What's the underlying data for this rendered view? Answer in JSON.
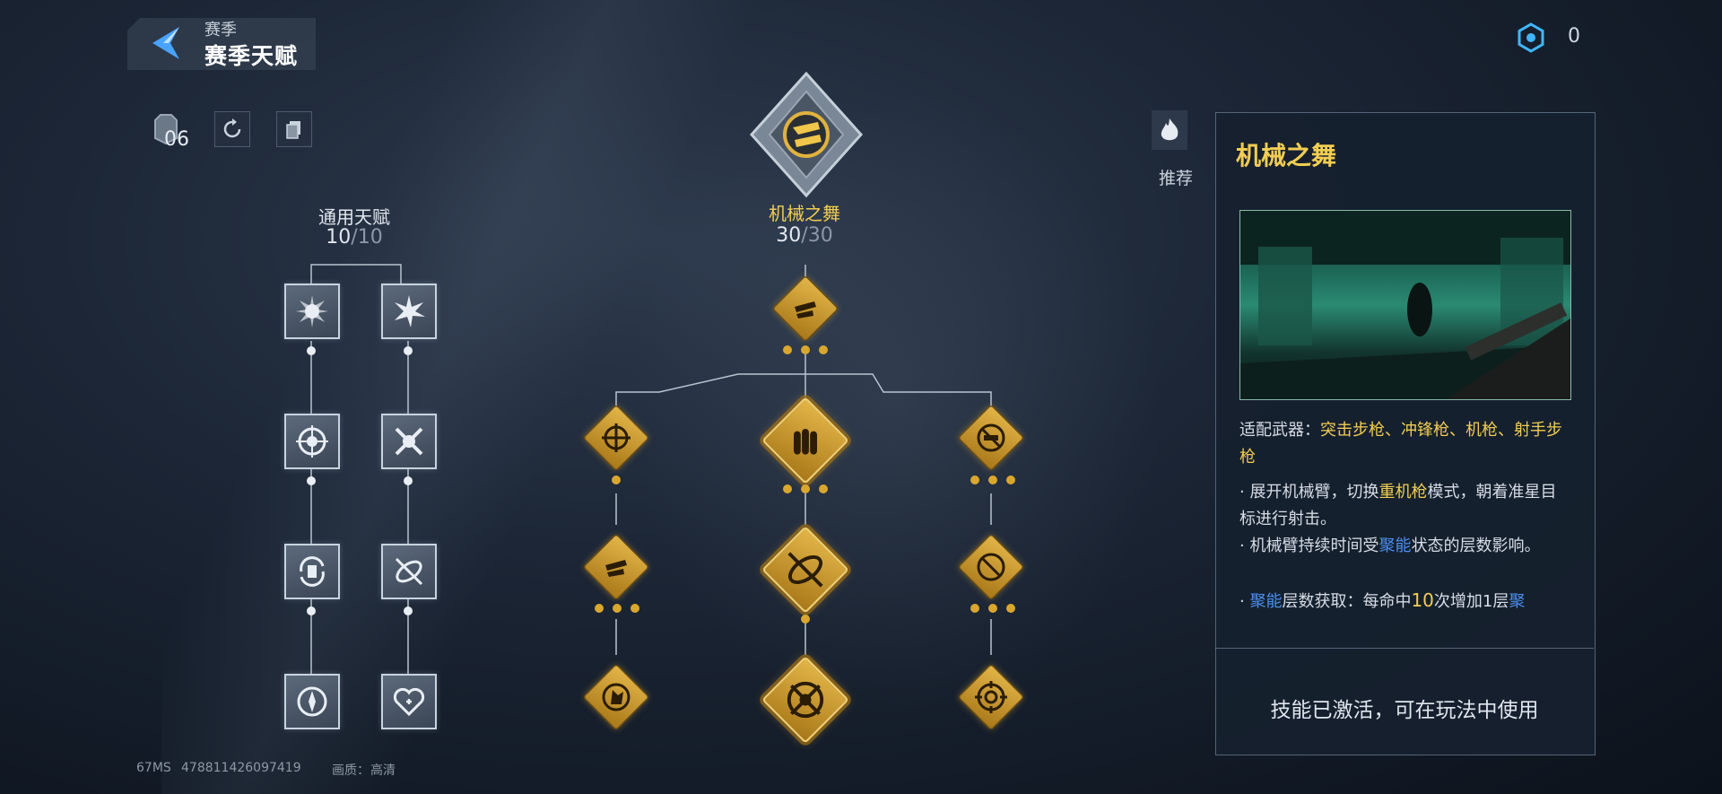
{
  "header": {
    "subtitle": "赛季",
    "title": "赛季天赋",
    "currency_value": "0"
  },
  "toolbar": {
    "points_value": "06"
  },
  "general_talent": {
    "title": "通用天赋",
    "current": "10",
    "max": "/10"
  },
  "special_talent": {
    "title": "机械之舞",
    "current": "30",
    "max": "/30"
  },
  "recommend": {
    "label": "推荐"
  },
  "panel": {
    "title": "机械之舞",
    "weapons_label": "适配武器：",
    "weapons_value": "突击步枪、冲锋枪、机枪、射手步枪",
    "desc1_a": "· 展开机械臂，切换",
    "desc1_highlight": "重机枪",
    "desc1_b": "模式，朝着准星目标进行射击。",
    "desc2_a": "· 机械臂持续时间受",
    "desc2_highlight": "聚能",
    "desc2_b": "状态的层数影响。",
    "desc3_a": "· ",
    "desc3_highlight1": "聚能",
    "desc3_b": "层数获取：每命中",
    "desc3_num": "10",
    "desc3_c": "次增加1层",
    "desc3_highlight2": "聚",
    "footer": "技能已激活，可在玩法中使用"
  },
  "footer": {
    "latency": "67MS",
    "user_id": "478811426097419",
    "quality_label": "画质：",
    "quality_value": "高清"
  },
  "colors": {
    "gold": "#f2cd52",
    "blue_highlight": "#4c8ff0",
    "node_gold": "#d9a72e"
  }
}
